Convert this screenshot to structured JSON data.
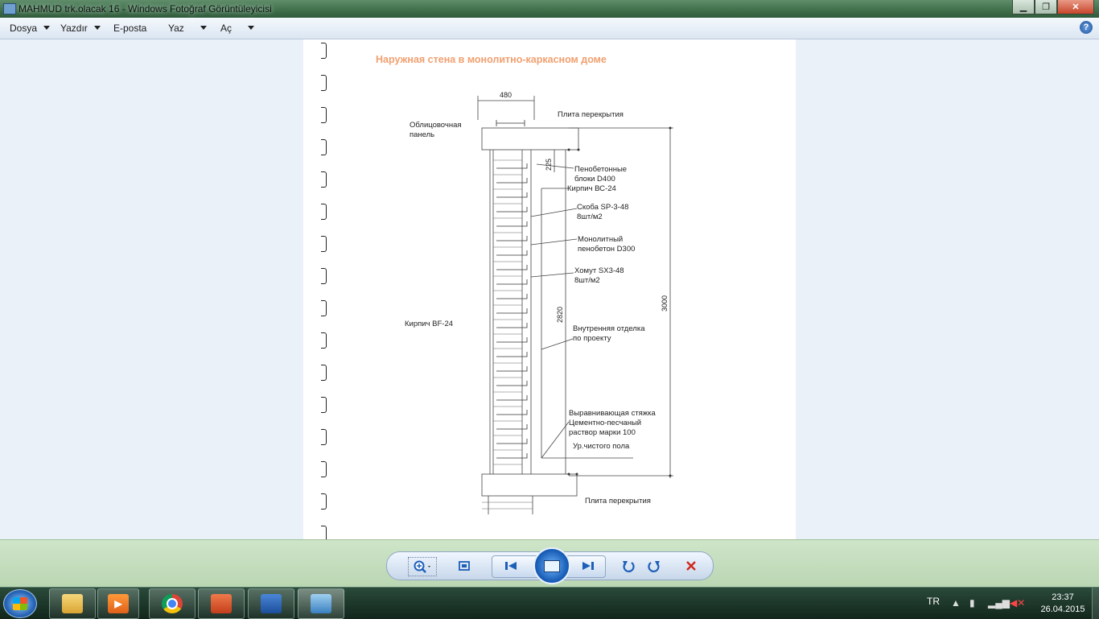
{
  "window": {
    "title": "MAHMUD trk.olacak 16 - Windows Fotoğraf Görüntüleyicisi",
    "min_glyph": "▁",
    "max_glyph": "❐",
    "close_glyph": "✕"
  },
  "menu": {
    "items": [
      {
        "label": "Dosya",
        "has_arrow": true
      },
      {
        "label": "Yazdır",
        "has_arrow": true
      },
      {
        "label": "E-posta",
        "has_arrow": false
      },
      {
        "label": "Yaz",
        "has_arrow": true
      },
      {
        "label": "Aç",
        "has_arrow": true
      }
    ],
    "help_glyph": "?"
  },
  "drawing": {
    "title": "Наружная стена в монолитно-каркасном доме",
    "dims": {
      "width": "480",
      "h225": "225",
      "h2820": "2820",
      "h3000": "3000"
    },
    "labels": {
      "plate_top": "Плита перекрытия",
      "cladding": "Облицовочная\nпанель",
      "foam_blocks": "Пенобетонные\nблоки D400",
      "brick_bs": "Кирпич ВС-24",
      "bracket": "Скоба SP-3-48\n8шт/м2",
      "monolith": "Монолитный\nпенобетон D300",
      "clamp": "Хомут SX3-48\n8шт/м2",
      "brick_bf": "Кирпич BF-24",
      "interior": "Внутренняя отделка\nпо проекту",
      "screed": "Выравнивающая стяжка\nЦементно-песчаный\nраствор марки 100",
      "floor_level": "Ур.чистого пола",
      "plate_bottom": "Плита перекрытия"
    }
  },
  "taskbar": {
    "lang": "TR",
    "time": "23:37",
    "date": "26.04.2015"
  }
}
